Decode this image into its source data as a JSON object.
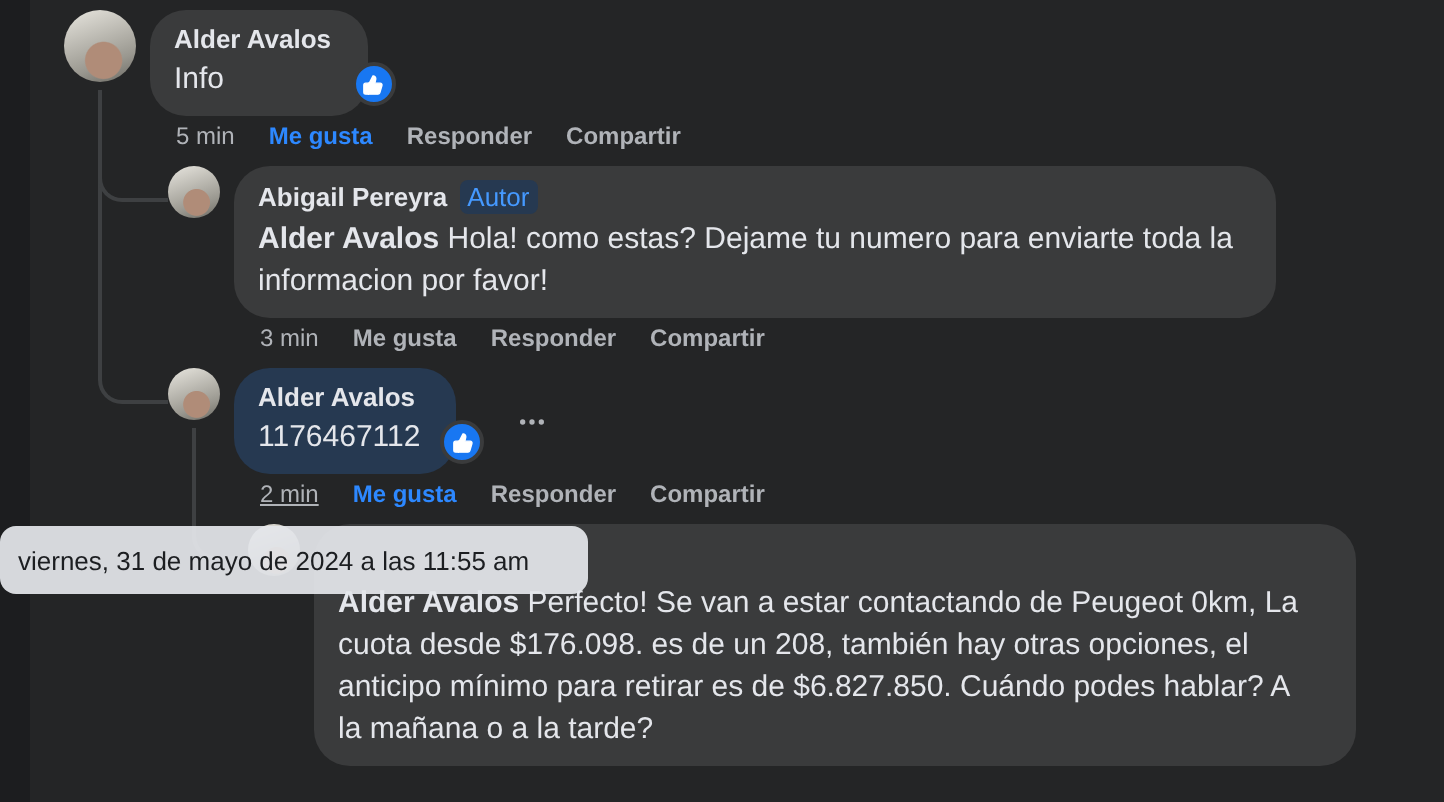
{
  "comments": [
    {
      "author": "Alder Avalos",
      "text": "Info",
      "highlighted": false,
      "reaction": true,
      "time": "5 min",
      "time_hovered": false,
      "actions": [
        {
          "label": "Me gusta",
          "selected": true
        },
        {
          "label": "Responder",
          "selected": false
        },
        {
          "label": "Compartir",
          "selected": false
        }
      ],
      "children": [
        {
          "author": "Abigail Pereyra",
          "badge": "Autor",
          "text": "**Alder Avalos** Hola! como estas? Dejame tu numero para enviarte toda la informacion por favor!",
          "highlighted": false,
          "time": "3 min",
          "time_hovered": false,
          "actions": [
            {
              "label": "Me gusta",
              "selected": false
            },
            {
              "label": "Responder",
              "selected": false
            },
            {
              "label": "Compartir",
              "selected": false
            }
          ]
        },
        {
          "author": "Alder Avalos",
          "text": "1176467112",
          "highlighted": true,
          "reaction": true,
          "more": true,
          "time": "2 min",
          "time_hovered": true,
          "actions": [
            {
              "label": "Me gusta",
              "selected": true
            },
            {
              "label": "Responder",
              "selected": false
            },
            {
              "label": "Compartir",
              "selected": false
            }
          ],
          "children": [
            {
              "text": "**Alder Avalos** Perfecto! Se van a estar contactando de Peugeot 0km, La cuota desde $176.098. es de un 208, también hay otras opciones, el anticipo mínimo para retirar es de $6.827.850. Cuándo podes hablar? A la mañana o a la tarde?",
              "highlighted": false
            }
          ]
        }
      ]
    }
  ],
  "tooltip": {
    "text": "viernes, 31 de mayo de 2024 a las 11:55 am"
  }
}
